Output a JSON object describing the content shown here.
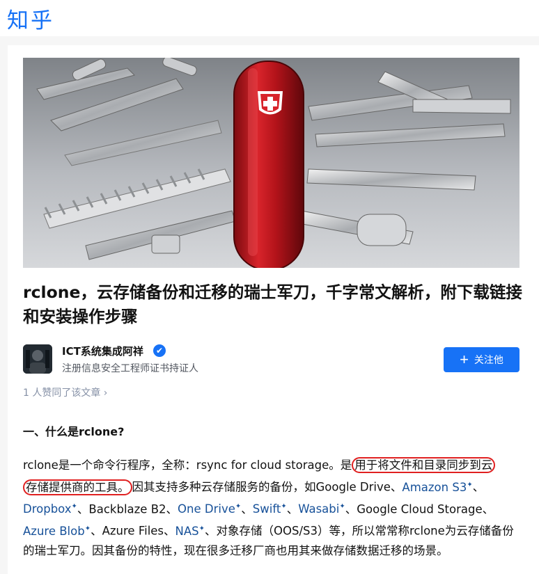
{
  "header": {
    "logo": "知乎"
  },
  "article": {
    "title": "rclone，云存储备份和迁移的瑞士军刀，千字常文解析，附下载链接和安装操作步骤",
    "author": {
      "name": "ICT系统集成阿祥",
      "description": "注册信息安全工程师证书持证人",
      "verified_icon": "✔"
    },
    "follow_button": "关注他",
    "likers": "1 人赞同了该文章 ›",
    "section_heading": "一、什么是rclone?",
    "paragraph": {
      "p1": "rclone是一个命令行程序，全称：rsync for cloud storage。是",
      "highlight1": "用于将文件和目录同步到云",
      "highlight2": "存储提供商的工具。",
      "p2": "因其支持多种云存储服务的备份，如Google Drive、",
      "link_amazon": "Amazon S3",
      "sep1": "、",
      "link_dropbox": "Dropbox",
      "p3": "、Backblaze B2、",
      "link_onedrive": "One Drive",
      "sep2": "、",
      "link_swift": "Swift",
      "sep3": "、",
      "link_wasabi": "Wasabi",
      "p4": "、Google Cloud Storage、",
      "link_azureblob": "Azure Blob",
      "p5": "、Azure Files、",
      "link_nas": "NAS",
      "p6": "、对象存储（OOS/S3）等，所以常常称rclone为云存储备份的瑞士军刀。因其备份的特性，现在很多迁移厂商也用其来做存储数据迁移的场景。",
      "link_mark": "✦"
    }
  },
  "colors": {
    "brand": "#1772f6",
    "link": "#175199",
    "highlight_circle": "#e02020"
  }
}
